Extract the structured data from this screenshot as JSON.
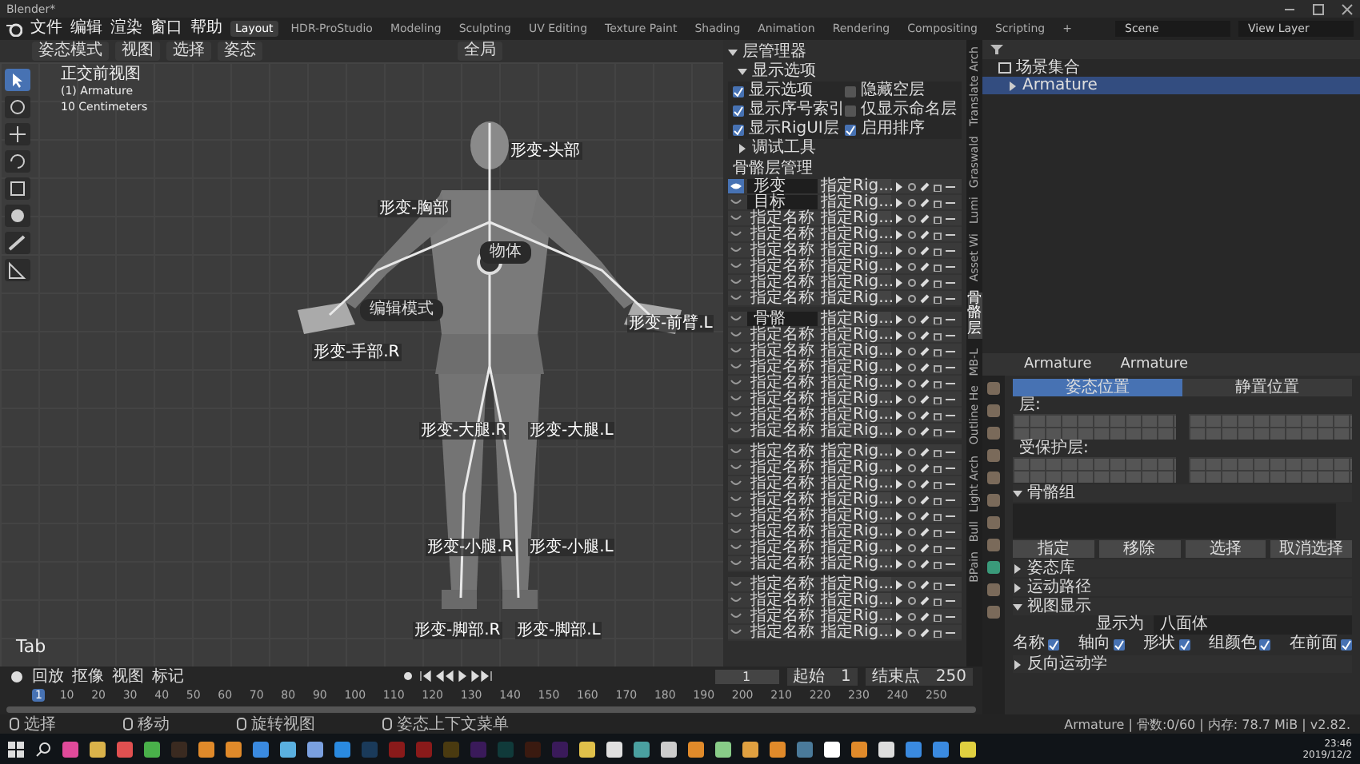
{
  "window": {
    "title": "Blender*"
  },
  "menu": [
    "文件",
    "编辑",
    "渲染",
    "窗口",
    "帮助"
  ],
  "workspaces": [
    {
      "label": "Layout",
      "selected": true
    },
    {
      "label": "HDR-ProStudio",
      "selected": false
    },
    {
      "label": "Modeling",
      "selected": false
    },
    {
      "label": "Sculpting",
      "selected": false
    },
    {
      "label": "UV Editing",
      "selected": false
    },
    {
      "label": "Texture Paint",
      "selected": false
    },
    {
      "label": "Shading",
      "selected": false
    },
    {
      "label": "Animation",
      "selected": false
    },
    {
      "label": "Rendering",
      "selected": false
    },
    {
      "label": "Compositing",
      "selected": false
    },
    {
      "label": "Scripting",
      "selected": false
    }
  ],
  "add_workspace": "+",
  "scene": "Scene",
  "view_layer": "View Layer",
  "viewport": {
    "mode": "姿态模式",
    "menus": [
      "视图",
      "选择",
      "姿态"
    ],
    "orientation": "全局",
    "overlay": [
      "正交前视图",
      "(1) Armature",
      "10 Centimeters"
    ],
    "key_hint": "Tab",
    "pie": [
      {
        "label": "物体"
      },
      {
        "label": "编辑模式"
      }
    ],
    "bones": [
      {
        "label": "形变-头部"
      },
      {
        "label": "形变-胸部"
      },
      {
        "label": "形变-前臂.L"
      },
      {
        "label": "形变-手部.R"
      },
      {
        "label": "形变-大腿.R"
      },
      {
        "label": "形变-大腿.L"
      },
      {
        "label": "形变-小腿.R"
      },
      {
        "label": "形变-小腿.L"
      },
      {
        "label": "形变-脚部.R"
      },
      {
        "label": "形变-脚部.L"
      }
    ]
  },
  "layer_manager": {
    "title": "层管理器",
    "display_section": "显示选项",
    "options": [
      {
        "label": "显示选项",
        "checked": true
      },
      {
        "label": "隐藏空层",
        "checked": false
      },
      {
        "label": "显示序号索引",
        "checked": true
      },
      {
        "label": "仅显示命名层",
        "checked": false
      },
      {
        "label": "显示RigUI层",
        "checked": true
      },
      {
        "label": "启用排序",
        "checked": true
      }
    ],
    "debug_section": "调试工具",
    "list_title": "骨骼层管理",
    "groups": [
      {
        "rows": [
          {
            "name": "形变",
            "kind": "field",
            "visible": true,
            "rig": "指定Rig..."
          },
          {
            "name": "目标",
            "kind": "field",
            "visible": false,
            "rig": "指定Rig..."
          },
          {
            "name": "指定名称",
            "kind": "label",
            "visible": false,
            "rig": "指定Rig..."
          },
          {
            "name": "指定名称",
            "kind": "label",
            "visible": false,
            "rig": "指定Rig..."
          },
          {
            "name": "指定名称",
            "kind": "label",
            "visible": false,
            "rig": "指定Rig..."
          },
          {
            "name": "指定名称",
            "kind": "label",
            "visible": false,
            "rig": "指定Rig..."
          },
          {
            "name": "指定名称",
            "kind": "label",
            "visible": false,
            "rig": "指定Rig..."
          },
          {
            "name": "指定名称",
            "kind": "label",
            "visible": false,
            "rig": "指定Rig..."
          }
        ]
      },
      {
        "rows": [
          {
            "name": "骨骼",
            "kind": "field",
            "visible": false,
            "rig": "指定Rig..."
          },
          {
            "name": "指定名称",
            "kind": "label",
            "visible": false,
            "rig": "指定Rig..."
          },
          {
            "name": "指定名称",
            "kind": "label",
            "visible": false,
            "rig": "指定Rig..."
          },
          {
            "name": "指定名称",
            "kind": "label",
            "visible": false,
            "rig": "指定Rig..."
          },
          {
            "name": "指定名称",
            "kind": "label",
            "visible": false,
            "rig": "指定Rig..."
          },
          {
            "name": "指定名称",
            "kind": "label",
            "visible": false,
            "rig": "指定Rig..."
          },
          {
            "name": "指定名称",
            "kind": "label",
            "visible": false,
            "rig": "指定Rig..."
          },
          {
            "name": "指定名称",
            "kind": "label",
            "visible": false,
            "rig": "指定Rig..."
          }
        ]
      },
      {
        "rows": [
          {
            "name": "指定名称",
            "kind": "label",
            "visible": false,
            "rig": "指定Rig..."
          },
          {
            "name": "指定名称",
            "kind": "label",
            "visible": false,
            "rig": "指定Rig..."
          },
          {
            "name": "指定名称",
            "kind": "label",
            "visible": false,
            "rig": "指定Rig..."
          },
          {
            "name": "指定名称",
            "kind": "label",
            "visible": false,
            "rig": "指定Rig..."
          },
          {
            "name": "指定名称",
            "kind": "label",
            "visible": false,
            "rig": "指定Rig..."
          },
          {
            "name": "指定名称",
            "kind": "label",
            "visible": false,
            "rig": "指定Rig..."
          },
          {
            "name": "指定名称",
            "kind": "label",
            "visible": false,
            "rig": "指定Rig..."
          },
          {
            "name": "指定名称",
            "kind": "label",
            "visible": false,
            "rig": "指定Rig..."
          }
        ]
      },
      {
        "rows": [
          {
            "name": "指定名称",
            "kind": "label",
            "visible": false,
            "rig": "指定Rig..."
          },
          {
            "name": "指定名称",
            "kind": "label",
            "visible": false,
            "rig": "指定Rig..."
          },
          {
            "name": "指定名称",
            "kind": "label",
            "visible": false,
            "rig": "指定Rig..."
          },
          {
            "name": "指定名称",
            "kind": "label",
            "visible": false,
            "rig": "指定Rig..."
          }
        ]
      }
    ]
  },
  "side_tabs": [
    {
      "label": "Translate Arch",
      "kind": "rotated",
      "selected": false
    },
    {
      "label": "Graswald",
      "kind": "rotated",
      "selected": false
    },
    {
      "label": "Lumi",
      "kind": "rotated",
      "selected": false
    },
    {
      "label": "Asset Wi",
      "kind": "rotated",
      "selected": false
    },
    {
      "label": "骨骼层",
      "kind": "stacked",
      "selected": true
    },
    {
      "label": "MB-L",
      "kind": "rotated",
      "selected": false
    },
    {
      "label": "Outline He",
      "kind": "rotated",
      "selected": false
    },
    {
      "label": "Light Arch",
      "kind": "rotated",
      "selected": false
    },
    {
      "label": "Bull",
      "kind": "rotated",
      "selected": false
    },
    {
      "label": "BPain",
      "kind": "rotated",
      "selected": false
    }
  ],
  "outliner": {
    "collection": "场景集合",
    "items": [
      {
        "label": "Armature",
        "selected": true
      }
    ]
  },
  "properties": {
    "object": "Armature",
    "data": "Armature",
    "pose_tabs": [
      {
        "label": "姿态位置",
        "selected": true
      },
      {
        "label": "静置位置",
        "selected": false
      }
    ],
    "layers_label": "层:",
    "protected_label": "受保护层:",
    "bone_groups": {
      "title": "骨骼组",
      "expanded": true,
      "buttons": [
        "指定",
        "移除",
        "选择",
        "取消选择"
      ]
    },
    "sections": [
      {
        "title": "姿态库",
        "expanded": false
      },
      {
        "title": "运动路径",
        "expanded": false
      },
      {
        "title": "视图显示",
        "expanded": true
      }
    ],
    "display_as_label": "显示为",
    "display_as": "八面体",
    "display_options": [
      {
        "label": "名称",
        "checked": true
      },
      {
        "label": "轴向",
        "checked": true
      },
      {
        "label": "形状",
        "checked": true
      },
      {
        "label": "组颜色",
        "checked": true
      },
      {
        "label": "在前面",
        "checked": true
      }
    ],
    "last_section": {
      "title": "反向运动学",
      "expanded": false
    }
  },
  "timeline": {
    "menus": [
      "回放",
      "抠像",
      "视图",
      "标记"
    ],
    "current_frame": "1",
    "start_label": "起始",
    "start": "1",
    "end_label": "结束点",
    "end": "250",
    "ticks": [
      {
        "label": "1",
        "selected": true
      },
      {
        "label": "10",
        "selected": false
      },
      {
        "label": "20",
        "selected": false
      },
      {
        "label": "30",
        "selected": false
      },
      {
        "label": "40",
        "selected": false
      },
      {
        "label": "50",
        "selected": false
      },
      {
        "label": "60",
        "selected": false
      },
      {
        "label": "70",
        "selected": false
      },
      {
        "label": "80",
        "selected": false
      },
      {
        "label": "90",
        "selected": false
      },
      {
        "label": "100",
        "selected": false
      },
      {
        "label": "110",
        "selected": false
      },
      {
        "label": "120",
        "selected": false
      },
      {
        "label": "130",
        "selected": false
      },
      {
        "label": "140",
        "selected": false
      },
      {
        "label": "150",
        "selected": false
      },
      {
        "label": "160",
        "selected": false
      },
      {
        "label": "170",
        "selected": false
      },
      {
        "label": "180",
        "selected": false
      },
      {
        "label": "190",
        "selected": false
      },
      {
        "label": "200",
        "selected": false
      },
      {
        "label": "210",
        "selected": false
      },
      {
        "label": "220",
        "selected": false
      },
      {
        "label": "230",
        "selected": false
      },
      {
        "label": "240",
        "selected": false
      },
      {
        "label": "250",
        "selected": false
      }
    ]
  },
  "status_bar": {
    "hints": [
      "选择",
      "移动",
      "旋转视图",
      "姿态上下文菜单"
    ],
    "info": "Armature | 骨数:0/60 | 内存: 78.7 MiB | v2.82."
  },
  "taskbar": {
    "time": "23:46",
    "date": "2019/12/2"
  }
}
